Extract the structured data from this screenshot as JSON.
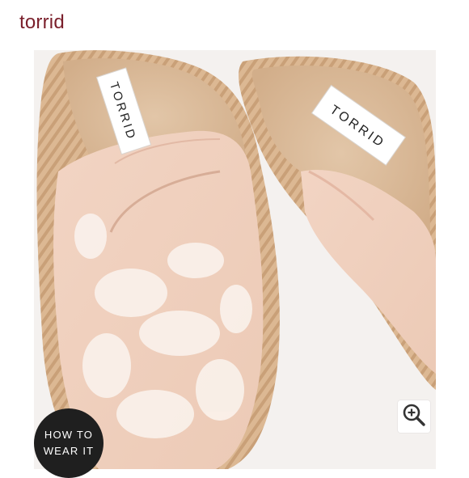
{
  "header": {
    "brand": "torrid"
  },
  "product_image": {
    "label_left": "TORRID",
    "label_right": "TORRID"
  },
  "zoom": {
    "icon": "zoom-in-icon"
  },
  "how_to": {
    "line1": "HOW TO",
    "line2": "WEAR IT"
  },
  "colors": {
    "brand": "#7a1f2b",
    "shoe_blush": "#efcbb8",
    "jute": "#d9b38f",
    "badge": "#1f1f1f"
  }
}
